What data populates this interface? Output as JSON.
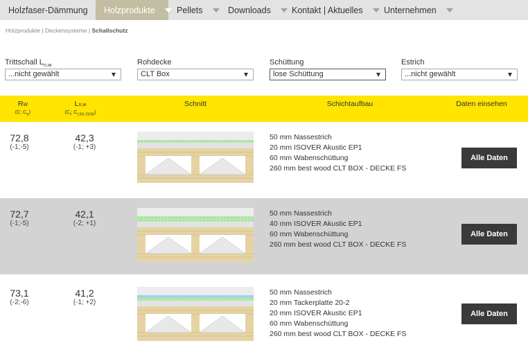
{
  "nav": [
    {
      "label": "Holzfaser-Dämmung",
      "active": false
    },
    {
      "label": "Holzprodukte",
      "active": true
    },
    {
      "label": "Pellets",
      "active": false
    },
    {
      "label": "Downloads",
      "active": false
    },
    {
      "label": "Kontakt | Aktuelles",
      "active": false
    },
    {
      "label": "Unternehmen",
      "active": false
    }
  ],
  "breadcrumb": {
    "items": [
      "Holzprodukte",
      "Deckensysteme"
    ],
    "separator": "|",
    "current": "Schallschutz"
  },
  "filters": [
    {
      "label_main": "Trittschall L",
      "label_sub": "n,w",
      "value": "...nicht gewählt"
    },
    {
      "label_main": "Rohdecke",
      "label_sub": "",
      "value": "CLT Box"
    },
    {
      "label_main": "Schüttung",
      "label_sub": "",
      "value": "lose Schüttung"
    },
    {
      "label_main": "Estrich",
      "label_sub": "",
      "value": "...nicht gewählt"
    }
  ],
  "table_header": {
    "rw_main": "R",
    "rw_sub": "W",
    "rw_note": "(C; C",
    "rw_note_sub": "tr",
    "rw_note_end": ")",
    "lnw_main": "L",
    "lnw_sub": "n,w",
    "lnw_note": "(C",
    "lnw_note_sub1": "I",
    "lnw_note_mid": "; C",
    "lnw_note_sub2": "I,50-2500",
    "lnw_note_end": ")",
    "schnitt": "Schnitt",
    "schichtaufbau": "Schichtaufbau",
    "daten": "Daten einsehen"
  },
  "rows": [
    {
      "rw": "72,8",
      "rw_c": "(-1;-5)",
      "lnw": "42,3",
      "lnw_c": "(-1; +3)",
      "layers": [
        "50 mm Nassestrich",
        "20 mm ISOVER Akustic EP1",
        "60 mm Wabenschüttung",
        "260 mm best wood CLT BOX - DECKE FS"
      ],
      "button": "Alle Daten",
      "highlight": false
    },
    {
      "rw": "72,7",
      "rw_c": "(-1;-5)",
      "lnw": "42,1",
      "lnw_c": "(-2; +1)",
      "layers": [
        "50 mm Nassestrich",
        "40 mm ISOVER Akustic EP1",
        "60 mm Wabenschüttung",
        "260 mm best wood CLT BOX - DECKE FS"
      ],
      "button": "Alle Daten",
      "highlight": true
    },
    {
      "rw": "73,1",
      "rw_c": "(-2;-6)",
      "lnw": "41,2",
      "lnw_c": "(-1; +2)",
      "layers": [
        "50 mm Nassestrich",
        "20 mm Tackerplatte 20-2",
        "20 mm ISOVER Akustic EP1",
        "60 mm Wabenschüttung",
        "260 mm best wood CLT BOX - DECKE FS"
      ],
      "button": "Alle Daten",
      "highlight": false
    }
  ],
  "colors": {
    "accent_yellow": "#ffe500",
    "nav_active": "#c3bda3",
    "button": "#3a3a3a",
    "wood": "#e5d3a3",
    "insulation": "#b9eab0"
  }
}
